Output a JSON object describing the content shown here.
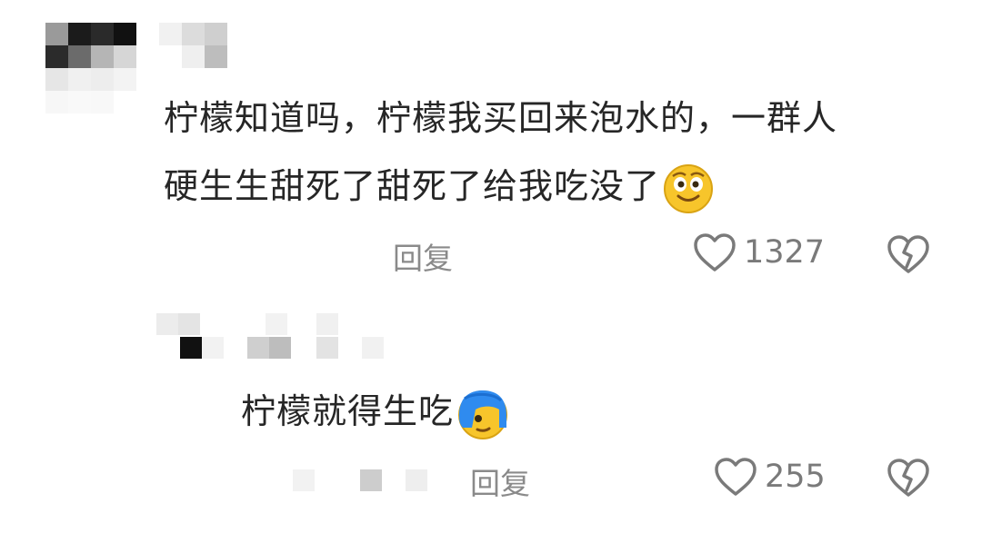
{
  "comments": [
    {
      "text_line1": "柠檬知道吗，柠檬我买回来泡水的，一群人",
      "text_line2": "硬生生甜死了甜死了给我吃没了",
      "emoji": "grinning-face-emoji",
      "reply_label": "回复",
      "like_count": "1327",
      "like_icon": "heart-outline-icon",
      "dislike_icon": "broken-heart-icon"
    },
    {
      "text": "柠檬就得生吃",
      "emoji": "blue-hair-face-emoji",
      "reply_label": "回复",
      "like_count": "255",
      "like_icon": "heart-outline-icon",
      "dislike_icon": "broken-heart-icon"
    }
  ],
  "colors": {
    "text": "#262626",
    "muted": "#8a8a8a",
    "icon": "#7a7a7a",
    "emoji_yellow": "#f7c52b",
    "emoji_blue": "#2f8bef"
  }
}
